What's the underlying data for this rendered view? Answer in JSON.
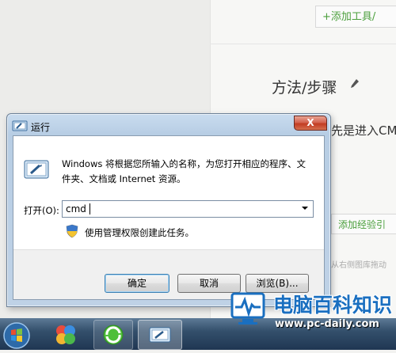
{
  "background_page": {
    "add_tool_label": "+添加工具/",
    "method_title": "方法/步骤",
    "step_text": "先是进入CM",
    "add_experience_label": "添加经验引",
    "hint_text": "从右侧图库拖动"
  },
  "run_dialog": {
    "title": "运行",
    "close_symbol": "X",
    "description": "Windows 将根据您所输入的名称，为您打开相应的程序、文件夹、文档或 Internet 资源。",
    "open_label": "打开(O):",
    "open_value": "cmd",
    "admin_text": "使用管理权限创建此任务。",
    "buttons": {
      "ok": "确定",
      "cancel": "取消",
      "browse": "浏览(B)..."
    }
  },
  "watermark": {
    "title": "电脑百科知识",
    "url": "www.pc-daily.com"
  },
  "colors": {
    "accent_green": "#4b9f3c",
    "watermark_blue": "#1a6fc0",
    "taskbar": "#34506c"
  }
}
